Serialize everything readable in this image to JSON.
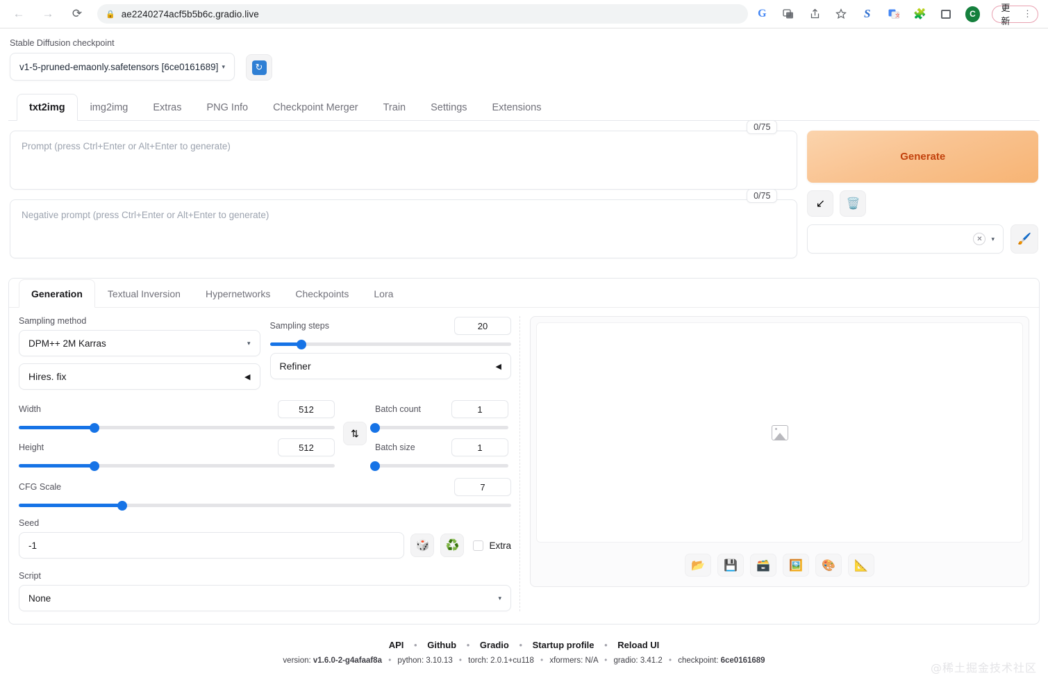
{
  "browser": {
    "back_icon": "←",
    "forward_icon": "→",
    "reload_icon": "⟳",
    "lock_icon": "🔒",
    "url": "ae2240274acf5b5b6c.gradio.live",
    "google_icon": "G",
    "translate_page_icon": "🗐",
    "share_icon": "↥",
    "bookmark_icon": "☆",
    "sogou_icon": "S",
    "gtranslate_ext_icon": "🗟",
    "extensions_icon": "🧩",
    "sidepanel_icon": "",
    "profile_initial": "C",
    "update_label": "更新",
    "menu_icon": "⋮"
  },
  "checkpoint": {
    "label": "Stable Diffusion checkpoint",
    "value": "v1-5-pruned-emaonly.safetensors [6ce0161689]",
    "caret": "▾",
    "refresh_icon": "🔄"
  },
  "tabs": [
    {
      "label": "txt2img",
      "active": true
    },
    {
      "label": "img2img",
      "active": false
    },
    {
      "label": "Extras",
      "active": false
    },
    {
      "label": "PNG Info",
      "active": false
    },
    {
      "label": "Checkpoint Merger",
      "active": false
    },
    {
      "label": "Train",
      "active": false
    },
    {
      "label": "Settings",
      "active": false
    },
    {
      "label": "Extensions",
      "active": false
    }
  ],
  "prompt": {
    "placeholder": "Prompt (press Ctrl+Enter or Alt+Enter to generate)",
    "token_count": "0/75"
  },
  "negative_prompt": {
    "placeholder": "Negative prompt (press Ctrl+Enter or Alt+Enter to generate)",
    "token_count": "0/75"
  },
  "generate": {
    "label": "Generate",
    "paste_icon": "↙",
    "clear_icon": "🗑️",
    "styles_value": "",
    "clear_x": "✕",
    "caret": "▾",
    "brush_icon": "🖌️"
  },
  "subtabs": [
    {
      "label": "Generation",
      "active": true
    },
    {
      "label": "Textual Inversion",
      "active": false
    },
    {
      "label": "Hypernetworks",
      "active": false
    },
    {
      "label": "Checkpoints",
      "active": false
    },
    {
      "label": "Lora",
      "active": false
    }
  ],
  "params": {
    "sampling_method": {
      "label": "Sampling method",
      "value": "DPM++ 2M Karras",
      "caret": "▾"
    },
    "sampling_steps": {
      "label": "Sampling steps",
      "value": "20",
      "percent": 13
    },
    "hires_fix": {
      "label": "Hires. fix",
      "arrow": "◀"
    },
    "refiner": {
      "label": "Refiner",
      "arrow": "◀"
    },
    "width": {
      "label": "Width",
      "value": "512",
      "percent": 24
    },
    "height": {
      "label": "Height",
      "value": "512",
      "percent": 24
    },
    "swap_icon": "⇅",
    "batch_count": {
      "label": "Batch count",
      "value": "1",
      "percent": 0
    },
    "batch_size": {
      "label": "Batch size",
      "value": "1",
      "percent": 0
    },
    "cfg_scale": {
      "label": "CFG Scale",
      "value": "7",
      "percent": 21
    },
    "seed": {
      "label": "Seed",
      "value": "-1",
      "dice_icon": "🎲",
      "recycle_icon": "♻️",
      "extra_label": "Extra"
    },
    "script": {
      "label": "Script",
      "value": "None",
      "caret": "▾"
    }
  },
  "output": {
    "placeholder_icon": "image-placeholder",
    "tools": [
      {
        "icon": "📂",
        "name": "open-folder"
      },
      {
        "icon": "💾",
        "name": "save"
      },
      {
        "icon": "🗃️",
        "name": "save-zip"
      },
      {
        "icon": "🖼️",
        "name": "send-to-img2img"
      },
      {
        "icon": "🎨",
        "name": "send-to-inpaint"
      },
      {
        "icon": "📐",
        "name": "send-to-extras"
      }
    ]
  },
  "footer": {
    "links": [
      "API",
      "Github",
      "Gradio",
      "Startup profile",
      "Reload UI"
    ],
    "separator": "•",
    "version_parts": [
      {
        "key": "version: ",
        "val": "v1.6.0-2-g4afaaf8a"
      },
      {
        "key": "python: ",
        "val": "3.10.13"
      },
      {
        "key": "torch: ",
        "val": "2.0.1+cu118"
      },
      {
        "key": "xformers: ",
        "val": "N/A"
      },
      {
        "key": "gradio: ",
        "val": "3.41.2"
      },
      {
        "key": "checkpoint: ",
        "val": "6ce0161689"
      }
    ]
  },
  "watermark": "@稀土掘金技术社区",
  "colors": {
    "accent_blue": "#1673e6",
    "generate_orange": "#f7b474",
    "generate_text": "#c2410c"
  }
}
